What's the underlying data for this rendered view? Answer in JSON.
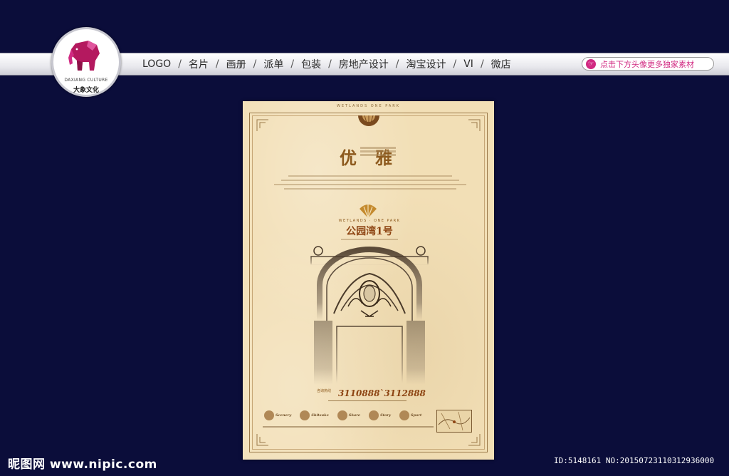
{
  "brand": {
    "name_en": "DAXIANG CULTURE",
    "name_cn": "大象文化",
    "accent": "#d12a82"
  },
  "nav": {
    "items": [
      "LOGO",
      "名片",
      "画册",
      "派单",
      "包装",
      "房地产设计",
      "淘宝设计",
      "VI",
      "微店"
    ],
    "separator": "/",
    "promo_text": "点击下方头像更多独家素材"
  },
  "poster": {
    "top_en": "WETLANDS ONE PARK",
    "headline": "优雅",
    "brand_en": "WETLANDS · ONE PARK",
    "brand_cn": "公园湾1号",
    "hotline_label": "咨询热线",
    "hotline": "3110888`3112888",
    "features": [
      {
        "en": "Scenery"
      },
      {
        "en": "Shitsuke"
      },
      {
        "en": "Share"
      },
      {
        "en": "Story"
      },
      {
        "en": "Sport"
      }
    ]
  },
  "watermark": {
    "site": "昵图网 www.nipic.com",
    "id": "ID:5148161 NO:20150723110312936000"
  }
}
